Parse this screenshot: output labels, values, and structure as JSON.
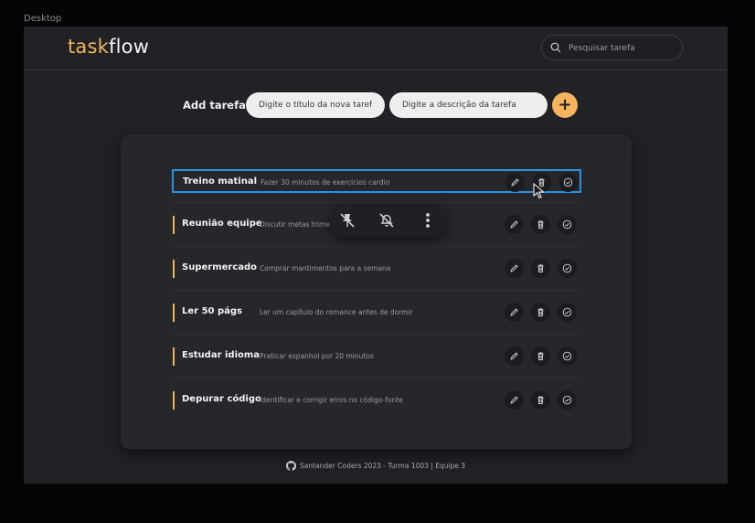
{
  "window": {
    "desktop_label": "Desktop"
  },
  "header": {
    "logo_part1": "task",
    "logo_part2": "flow",
    "search_placeholder": "Pesquisar tarefa"
  },
  "add_form": {
    "label": "Add tarefa:",
    "title_placeholder": "Digite o título da nova tarefa",
    "description_placeholder": "Digite a descrição da tarefa",
    "add_button": "+"
  },
  "tasks": [
    {
      "name": "Treino matinal",
      "description": "Fazer 30 minutos de exercícios cardio",
      "selected": true
    },
    {
      "name": "Reunião equipe",
      "description": "Discutir metas trimestrais com colegas",
      "selected": false
    },
    {
      "name": "Supermercado",
      "description": "Comprar mantimentos para a semana",
      "selected": false
    },
    {
      "name": "Ler 50 págs",
      "description": "Ler um capítulo do romance antes de dormir",
      "selected": false
    },
    {
      "name": "Estudar idioma",
      "description": "Praticar espanhol por 20 minutos",
      "selected": false
    },
    {
      "name": "Depurar código",
      "description": "Identificar e corrigir erros no código-fonte",
      "selected": false
    }
  ],
  "task_actions": [
    "pencil-icon",
    "trash-icon",
    "check-circle-icon"
  ],
  "floating_toolbar": [
    "pin-off-icon",
    "bell-off-icon",
    "more-vertical-icon"
  ],
  "footer": {
    "text": "Santander Coders 2023 - Turma 1003 | Equipe 3"
  },
  "colors": {
    "accent": "#f5b45d",
    "selection": "#2f8fe0",
    "background": "#202226"
  }
}
